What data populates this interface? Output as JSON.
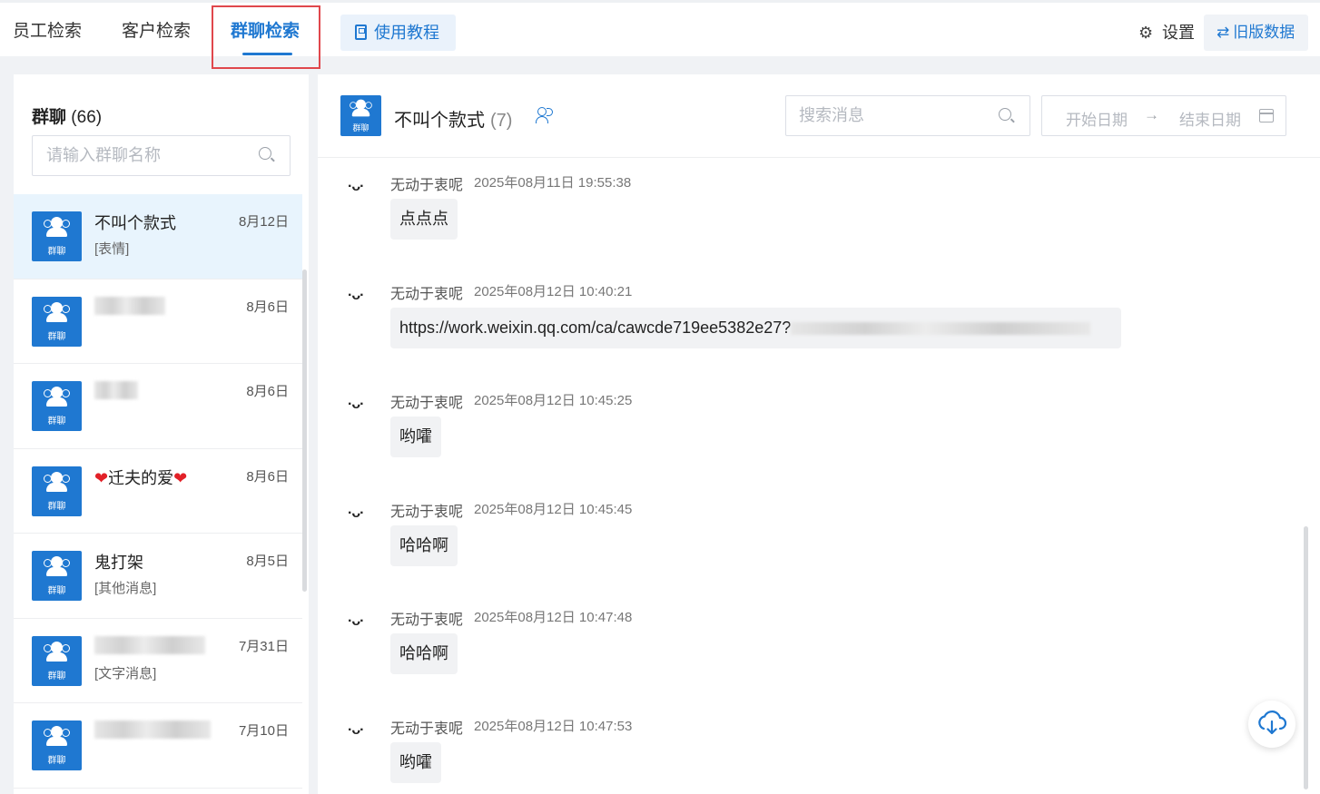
{
  "tabs": [
    {
      "label": "员工检索",
      "active": false
    },
    {
      "label": "客户检索",
      "active": false
    },
    {
      "label": "群聊检索",
      "active": true
    }
  ],
  "tutorial": {
    "label": "使用教程",
    "icon": "book-icon"
  },
  "settings": {
    "label": "设置",
    "icon": "gear-icon"
  },
  "old_data": {
    "label": "旧版数据",
    "icon": "swap-icon"
  },
  "sidebar": {
    "title": "群聊",
    "count": "(66)",
    "search_placeholder": "请输入群聊名称",
    "avatar_label": "群聊",
    "groups": [
      {
        "name": "不叫个款式",
        "date": "8月12日",
        "sub": "[表情]",
        "selected": true
      },
      {
        "name": "",
        "date": "8月6日",
        "sub": "",
        "blurred": true
      },
      {
        "name": "",
        "date": "8月6日",
        "sub": "",
        "blurred": true
      },
      {
        "name": "迁夫的爱",
        "date": "8月6日",
        "sub": ""
      },
      {
        "name": "鬼打架",
        "date": "8月5日",
        "sub": "[其他消息]"
      },
      {
        "name": "",
        "date": "7月31日",
        "sub": "[文字消息]",
        "blurred": true
      },
      {
        "name": "",
        "date": "7月10日",
        "sub": "",
        "blurred": true
      }
    ]
  },
  "chat": {
    "title": "不叫个款式",
    "member_count": "(7)",
    "avatar_label": "群聊",
    "search_placeholder": "搜索消息",
    "date_start": "开始日期",
    "date_arrow": "→",
    "date_end": "结束日期",
    "messages": [
      {
        "face": "·ᴗ·",
        "sender": "无动于衷呢",
        "time": "2025年08月11日 19:55:38",
        "text": "点点点"
      },
      {
        "face": "·ᴗ·",
        "sender": "无动于衷呢",
        "time": "2025年08月12日 10:40:21",
        "text": "https://work.weixin.qq.com/ca/cawcde719ee5382e27?",
        "link_blurred": true
      },
      {
        "face": "·ᴗ·",
        "sender": "无动于衷呢",
        "time": "2025年08月12日 10:45:25",
        "text": "哟嚯"
      },
      {
        "face": "·ᴗ·",
        "sender": "无动于衷呢",
        "time": "2025年08月12日 10:45:45",
        "text": "哈哈啊"
      },
      {
        "face": "·ᴗ·",
        "sender": "无动于衷呢",
        "time": "2025年08月12日 10:47:48",
        "text": "哈哈啊"
      },
      {
        "face": "·ᴗ·",
        "sender": "无动于衷呢",
        "time": "2025年08月12日 10:47:53",
        "text": "哟嚯"
      }
    ]
  },
  "download": {
    "icon": "cloud-download-icon"
  },
  "colors": {
    "accent": "#1f78d1",
    "highlight_border": "#e0474c",
    "selected_bg": "#e8f4fd"
  }
}
